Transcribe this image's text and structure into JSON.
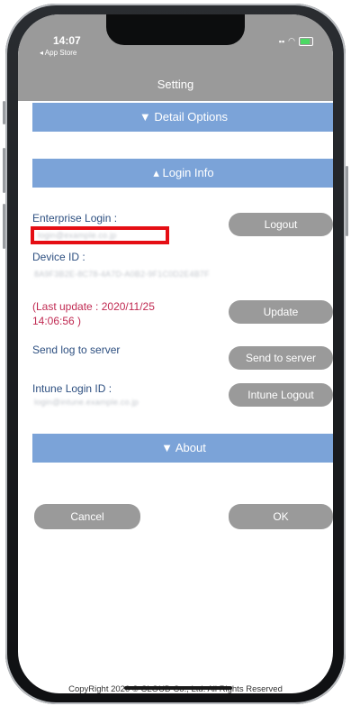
{
  "status": {
    "time": "14:07",
    "back_app": "◂ App Store"
  },
  "nav": {
    "title": "Setting"
  },
  "sections": {
    "detail": "▼ Detail Options",
    "login": "▴ Login Info",
    "about": "▼ About"
  },
  "login": {
    "enterprise_label": "Enterprise Login :",
    "enterprise_value": "login@example.co.jp",
    "logout_button": "Logout",
    "device_label": "Device ID :",
    "device_value": "8A9F3B2E-8C78-4A7D-A0B2-9F1C0D2E4B7F",
    "last_update": "(Last update : 2020/11/25 14:06:56 )",
    "update_button": "Update",
    "send_log_label": "Send log to server",
    "send_button": "Send to server",
    "intune_label": "Intune Login ID :",
    "intune_value": "login@intune.example.co.jp",
    "intune_logout_button": "Intune Logout"
  },
  "actions": {
    "cancel": "Cancel",
    "ok": "OK"
  },
  "footer": "CopyRight 2020 © CLOUD Co., Ltd. All Rights Reserved",
  "colors": {
    "section": "#7ba3d8",
    "button": "#9a9a9a",
    "highlight": "#e50e14",
    "accent_text": "#c02a52"
  }
}
